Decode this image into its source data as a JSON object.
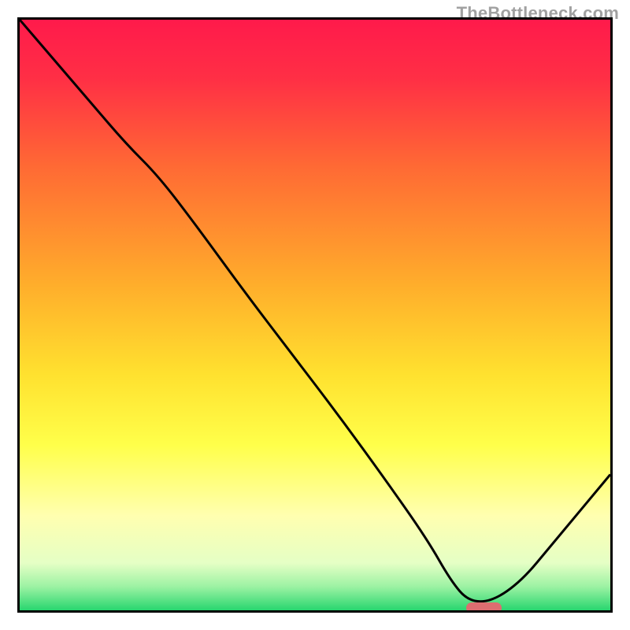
{
  "watermark": "TheBottleneck.com",
  "chart_data": {
    "type": "line",
    "title": "",
    "xlabel": "",
    "ylabel": "",
    "xlim": [
      0,
      100
    ],
    "ylim": [
      0,
      100
    ],
    "gradient_stops": [
      {
        "pos": 0,
        "color": "#ff1a4b"
      },
      {
        "pos": 10,
        "color": "#ff2f45"
      },
      {
        "pos": 25,
        "color": "#ff6a34"
      },
      {
        "pos": 45,
        "color": "#ffae2b"
      },
      {
        "pos": 60,
        "color": "#ffe12f"
      },
      {
        "pos": 72,
        "color": "#ffff4a"
      },
      {
        "pos": 84,
        "color": "#ffffb0"
      },
      {
        "pos": 92,
        "color": "#e5ffc5"
      },
      {
        "pos": 96,
        "color": "#9cf2a3"
      },
      {
        "pos": 100,
        "color": "#28d66f"
      }
    ],
    "x": [
      0,
      6,
      12,
      18,
      23.5,
      30,
      38,
      46,
      54,
      62,
      69,
      73,
      76,
      80,
      85,
      90,
      95,
      100
    ],
    "values": [
      100,
      93,
      86,
      79,
      73.5,
      65,
      54,
      43.5,
      33,
      22,
      12,
      5,
      1.5,
      1.5,
      5,
      11,
      17,
      23
    ],
    "series_name": "bottleneck-curve",
    "marker": {
      "x_start": 75,
      "x_end": 81,
      "y": 1.2,
      "color": "#dd6d70"
    }
  }
}
